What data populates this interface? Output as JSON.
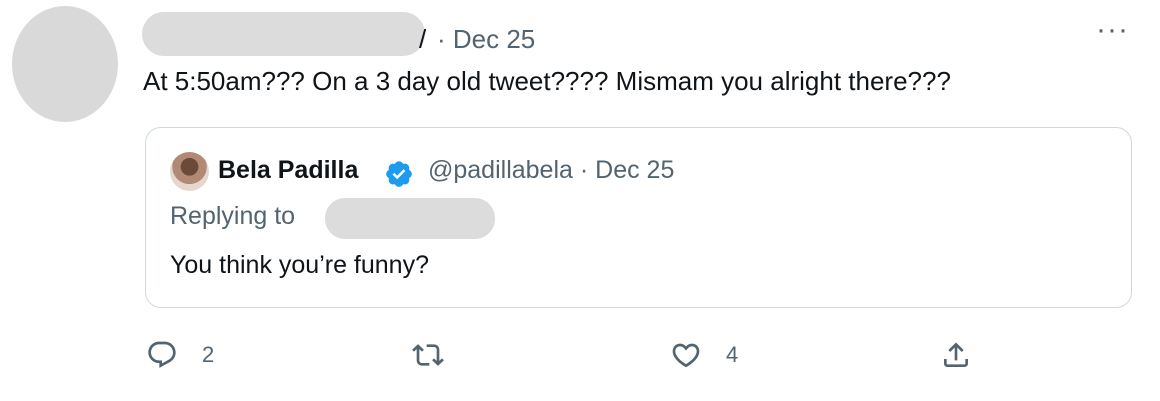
{
  "tweet": {
    "name_tail": "/",
    "meta": "· Dec 25",
    "more_label": "···",
    "text": "At 5:50am??? On a 3 day old tweet???? Mismam you alright there???"
  },
  "quoted": {
    "name": "Bela Padilla",
    "handle_date": "@padillabela · Dec 25",
    "replying_to": "Replying to",
    "text": "You think you’re funny?"
  },
  "actions": {
    "reply_count": "2",
    "retweet_count": "",
    "like_count": "4"
  },
  "colors": {
    "text": "#0f1419",
    "secondary": "#536471",
    "verified": "#1d9bf0",
    "border": "#cfd9de"
  }
}
